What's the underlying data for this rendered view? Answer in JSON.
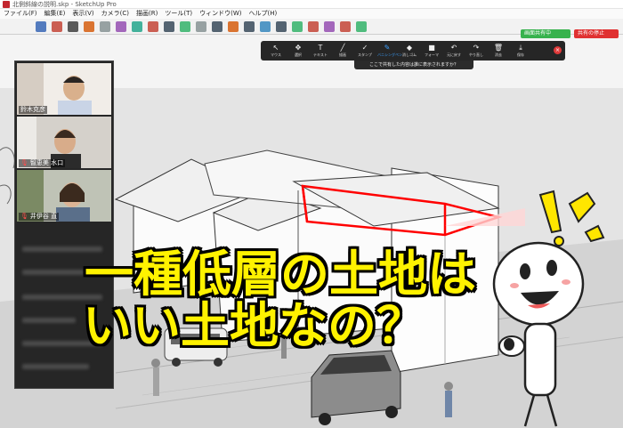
{
  "window": {
    "title": "北側斜線の説明.skp - SketchUp Pro"
  },
  "menu": [
    "ファイル(F)",
    "編集(E)",
    "表示(V)",
    "カメラ(C)",
    "描画(R)",
    "ツール(T)",
    "ウィンドウ(W)",
    "ヘルプ(H)"
  ],
  "toolbar_icons": [
    "select-icon",
    "eraser-icon",
    "pencil-icon",
    "arc-icon",
    "rectangle-icon",
    "pushpull-icon",
    "offset-icon",
    "move-icon",
    "rotate-icon",
    "scale-icon",
    "tape-icon",
    "text-icon",
    "paint-icon",
    "orbit-icon",
    "pan-icon",
    "zoom-icon",
    "zoom-extents-icon",
    "components-icon",
    "warehouse-icon",
    "extension-icon",
    "layout-icon"
  ],
  "share_toolbar": {
    "tools": [
      {
        "label": "マウス",
        "glyph": "↖",
        "icon": "mouse-icon"
      },
      {
        "label": "選択",
        "glyph": "✥",
        "icon": "select-icon"
      },
      {
        "label": "テキスト",
        "glyph": "T",
        "icon": "text-icon"
      },
      {
        "label": "描画",
        "glyph": "╱",
        "icon": "draw-icon"
      },
      {
        "label": "スタンプ",
        "glyph": "✓",
        "icon": "stamp-icon"
      },
      {
        "label": "バニシングペン",
        "glyph": "✎",
        "icon": "vanishing-pen-icon"
      },
      {
        "label": "消しゴム",
        "glyph": "◆",
        "icon": "eraser-icon"
      },
      {
        "label": "フォーマ",
        "glyph": "■",
        "icon": "format-icon"
      },
      {
        "label": "元に戻す",
        "glyph": "↶",
        "icon": "undo-icon"
      },
      {
        "label": "やり直し",
        "glyph": "↷",
        "icon": "redo-icon"
      },
      {
        "label": "消去",
        "glyph": "🗑",
        "icon": "clear-icon"
      },
      {
        "label": "保存",
        "glyph": "⤓",
        "icon": "save-icon"
      }
    ],
    "active_index": 5,
    "close_label": "×"
  },
  "ask_bar": "ここで共有した内容は誰に表示されますか？",
  "sharing": {
    "status": "画面共有中",
    "stop": "共有の停止"
  },
  "participants": [
    {
      "name": "鈴木克彦",
      "muted": false
    },
    {
      "name": "智恵美 水口",
      "muted": true
    },
    {
      "name": "井伊谷 直",
      "muted": true
    }
  ],
  "headline": {
    "line1": "一種低層の土地は",
    "line2": "いい土地なの？"
  },
  "colors": {
    "headline": "#fff200",
    "outline": "#ff0000",
    "share_green": "#37b24d",
    "stop_red": "#e03131"
  }
}
